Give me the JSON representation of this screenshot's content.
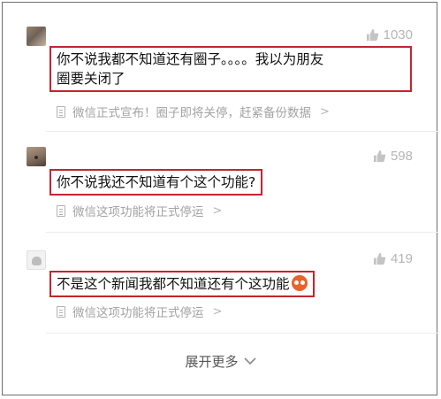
{
  "comments": [
    {
      "likes": "1030",
      "text_line1": "你不说我都不知道还有圈子。。。。我以为朋友",
      "text_line2": "圈要关闭了",
      "quote": "微信正式宣布！圈子即将关停，赶紧备份数据",
      "avatar_icon": "avatar-photo"
    },
    {
      "likes": "598",
      "text": "你不说我还不知道有个这个功能?",
      "quote": "微信这项功能将正式停运",
      "avatar_icon": "avatar-photo"
    },
    {
      "likes": "419",
      "text": "不是这个新闻我都不知道还有个这功能",
      "emoji": "orange-face-emoji",
      "quote": "微信这项功能将正式停运",
      "avatar_icon": "avatar-default"
    }
  ],
  "expand_more": "展开更多",
  "icons": {
    "like": "thumbs-up-icon",
    "quote": "document-icon",
    "chevron": "chevron-right-icon",
    "expand": "chevron-down-icon"
  },
  "colors": {
    "highlight_border": "#c3252f",
    "muted_text": "#a3a3a3",
    "body_text": "#111111"
  }
}
